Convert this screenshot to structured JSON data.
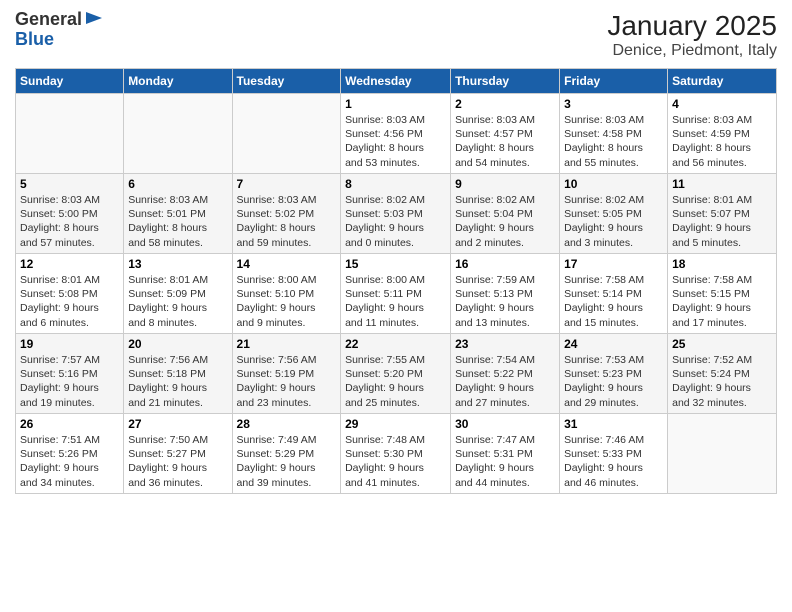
{
  "header": {
    "logo_general": "General",
    "logo_blue": "Blue",
    "title": "January 2025",
    "subtitle": "Denice, Piedmont, Italy"
  },
  "weekdays": [
    "Sunday",
    "Monday",
    "Tuesday",
    "Wednesday",
    "Thursday",
    "Friday",
    "Saturday"
  ],
  "weeks": [
    [
      {
        "day": "",
        "info": ""
      },
      {
        "day": "",
        "info": ""
      },
      {
        "day": "",
        "info": ""
      },
      {
        "day": "1",
        "info": "Sunrise: 8:03 AM\nSunset: 4:56 PM\nDaylight: 8 hours\nand 53 minutes."
      },
      {
        "day": "2",
        "info": "Sunrise: 8:03 AM\nSunset: 4:57 PM\nDaylight: 8 hours\nand 54 minutes."
      },
      {
        "day": "3",
        "info": "Sunrise: 8:03 AM\nSunset: 4:58 PM\nDaylight: 8 hours\nand 55 minutes."
      },
      {
        "day": "4",
        "info": "Sunrise: 8:03 AM\nSunset: 4:59 PM\nDaylight: 8 hours\nand 56 minutes."
      }
    ],
    [
      {
        "day": "5",
        "info": "Sunrise: 8:03 AM\nSunset: 5:00 PM\nDaylight: 8 hours\nand 57 minutes."
      },
      {
        "day": "6",
        "info": "Sunrise: 8:03 AM\nSunset: 5:01 PM\nDaylight: 8 hours\nand 58 minutes."
      },
      {
        "day": "7",
        "info": "Sunrise: 8:03 AM\nSunset: 5:02 PM\nDaylight: 8 hours\nand 59 minutes."
      },
      {
        "day": "8",
        "info": "Sunrise: 8:02 AM\nSunset: 5:03 PM\nDaylight: 9 hours\nand 0 minutes."
      },
      {
        "day": "9",
        "info": "Sunrise: 8:02 AM\nSunset: 5:04 PM\nDaylight: 9 hours\nand 2 minutes."
      },
      {
        "day": "10",
        "info": "Sunrise: 8:02 AM\nSunset: 5:05 PM\nDaylight: 9 hours\nand 3 minutes."
      },
      {
        "day": "11",
        "info": "Sunrise: 8:01 AM\nSunset: 5:07 PM\nDaylight: 9 hours\nand 5 minutes."
      }
    ],
    [
      {
        "day": "12",
        "info": "Sunrise: 8:01 AM\nSunset: 5:08 PM\nDaylight: 9 hours\nand 6 minutes."
      },
      {
        "day": "13",
        "info": "Sunrise: 8:01 AM\nSunset: 5:09 PM\nDaylight: 9 hours\nand 8 minutes."
      },
      {
        "day": "14",
        "info": "Sunrise: 8:00 AM\nSunset: 5:10 PM\nDaylight: 9 hours\nand 9 minutes."
      },
      {
        "day": "15",
        "info": "Sunrise: 8:00 AM\nSunset: 5:11 PM\nDaylight: 9 hours\nand 11 minutes."
      },
      {
        "day": "16",
        "info": "Sunrise: 7:59 AM\nSunset: 5:13 PM\nDaylight: 9 hours\nand 13 minutes."
      },
      {
        "day": "17",
        "info": "Sunrise: 7:58 AM\nSunset: 5:14 PM\nDaylight: 9 hours\nand 15 minutes."
      },
      {
        "day": "18",
        "info": "Sunrise: 7:58 AM\nSunset: 5:15 PM\nDaylight: 9 hours\nand 17 minutes."
      }
    ],
    [
      {
        "day": "19",
        "info": "Sunrise: 7:57 AM\nSunset: 5:16 PM\nDaylight: 9 hours\nand 19 minutes."
      },
      {
        "day": "20",
        "info": "Sunrise: 7:56 AM\nSunset: 5:18 PM\nDaylight: 9 hours\nand 21 minutes."
      },
      {
        "day": "21",
        "info": "Sunrise: 7:56 AM\nSunset: 5:19 PM\nDaylight: 9 hours\nand 23 minutes."
      },
      {
        "day": "22",
        "info": "Sunrise: 7:55 AM\nSunset: 5:20 PM\nDaylight: 9 hours\nand 25 minutes."
      },
      {
        "day": "23",
        "info": "Sunrise: 7:54 AM\nSunset: 5:22 PM\nDaylight: 9 hours\nand 27 minutes."
      },
      {
        "day": "24",
        "info": "Sunrise: 7:53 AM\nSunset: 5:23 PM\nDaylight: 9 hours\nand 29 minutes."
      },
      {
        "day": "25",
        "info": "Sunrise: 7:52 AM\nSunset: 5:24 PM\nDaylight: 9 hours\nand 32 minutes."
      }
    ],
    [
      {
        "day": "26",
        "info": "Sunrise: 7:51 AM\nSunset: 5:26 PM\nDaylight: 9 hours\nand 34 minutes."
      },
      {
        "day": "27",
        "info": "Sunrise: 7:50 AM\nSunset: 5:27 PM\nDaylight: 9 hours\nand 36 minutes."
      },
      {
        "day": "28",
        "info": "Sunrise: 7:49 AM\nSunset: 5:29 PM\nDaylight: 9 hours\nand 39 minutes."
      },
      {
        "day": "29",
        "info": "Sunrise: 7:48 AM\nSunset: 5:30 PM\nDaylight: 9 hours\nand 41 minutes."
      },
      {
        "day": "30",
        "info": "Sunrise: 7:47 AM\nSunset: 5:31 PM\nDaylight: 9 hours\nand 44 minutes."
      },
      {
        "day": "31",
        "info": "Sunrise: 7:46 AM\nSunset: 5:33 PM\nDaylight: 9 hours\nand 46 minutes."
      },
      {
        "day": "",
        "info": ""
      }
    ]
  ]
}
